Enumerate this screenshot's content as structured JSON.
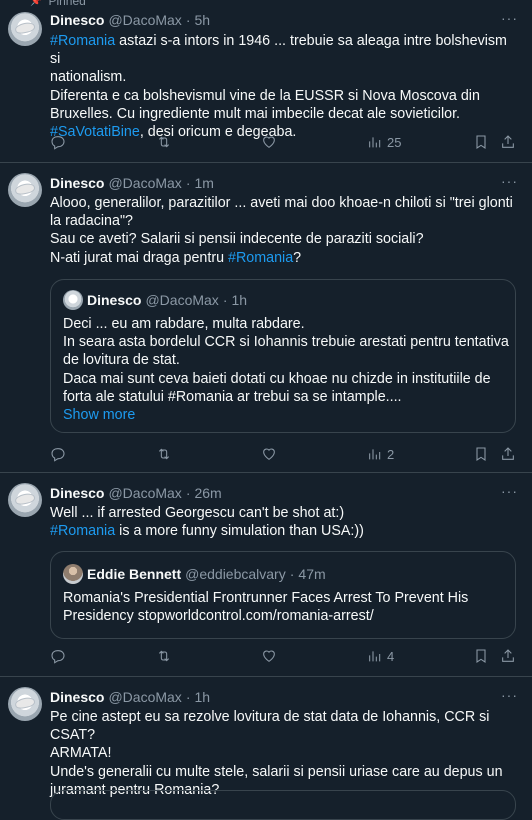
{
  "pinned_label": "Pinned",
  "tweets": [
    {
      "name": "Dinesco",
      "handle": "@DacoMax",
      "dot": "·",
      "time": "5h",
      "more": "···",
      "lines": [
        [
          "#Romania",
          " astazi s-a intors in 1946 ... trebuie sa aleaga intre bolshevism si"
        ],
        [
          "",
          "nationalism."
        ],
        [
          "",
          "Diferenta e ca bolshevismul vine de la EUSSR si Nova Moscova din"
        ],
        [
          "",
          "Bruxelles. Cu ingrediente mult mai imbecile decat ale sovieticilor."
        ],
        [
          "#SaVotatiBine",
          ", desi oricum e degeaba."
        ]
      ],
      "views": "25"
    },
    {
      "name": "Dinesco",
      "handle": "@DacoMax",
      "dot": "·",
      "time": "1m",
      "more": "···",
      "lines": [
        [
          "",
          "Alooo, generalilor, parazitilor ... aveti mai doo khoae-n chiloti si \"trei glonti"
        ],
        [
          "",
          "la radacina\"?"
        ],
        [
          "",
          "Sau ce aveti? Salarii si pensii indecente de paraziti sociali?"
        ],
        [
          "",
          "N-ati jurat mai draga pentru "
        ]
      ],
      "line4_tag": "#Romania",
      "line4_end": "?",
      "quote": {
        "name": "Dinesco",
        "handle": "@DacoMax",
        "dot": "·",
        "time": "1h",
        "lines": [
          "Deci ... eu am rabdare, multa rabdare.",
          "In seara asta bordelul CCR si Iohannis trebuie arestati pentru tentativa",
          "de lovitura de stat.",
          "Daca mai sunt ceva baieti dotati cu khoae nu chizde in institutiile de",
          "forta ale statului #Romania ar trebui sa se intample...."
        ],
        "show_more": "Show more"
      },
      "views": "2"
    },
    {
      "name": "Dinesco",
      "handle": "@DacoMax",
      "dot": "·",
      "time": "26m",
      "more": "···",
      "line1": "Well ... if arrested Georgescu can't be shot at:)",
      "line2_tag": "#Romania",
      "line2_rest": " is a more funny simulation than USA:))",
      "quote": {
        "name": "Eddie Bennett",
        "handle": "@eddiebcalvary",
        "dot": "·",
        "time": "47m",
        "lines": [
          "Romania's Presidential Frontrunner Faces Arrest To Prevent His",
          "Presidency  stopworldcontrol.com/romania-arrest/"
        ]
      },
      "views": "4"
    },
    {
      "name": "Dinesco",
      "handle": "@DacoMax",
      "dot": "·",
      "time": "1h",
      "more": "···",
      "lines": [
        "Pe cine astept eu sa rezolve lovitura de stat data de Iohannis, CCR si CSAT?",
        "ARMATA!",
        "Unde's generalii cu multe stele, salarii si pensii uriase care au depus un",
        "juramant pentru Romania?"
      ]
    }
  ]
}
